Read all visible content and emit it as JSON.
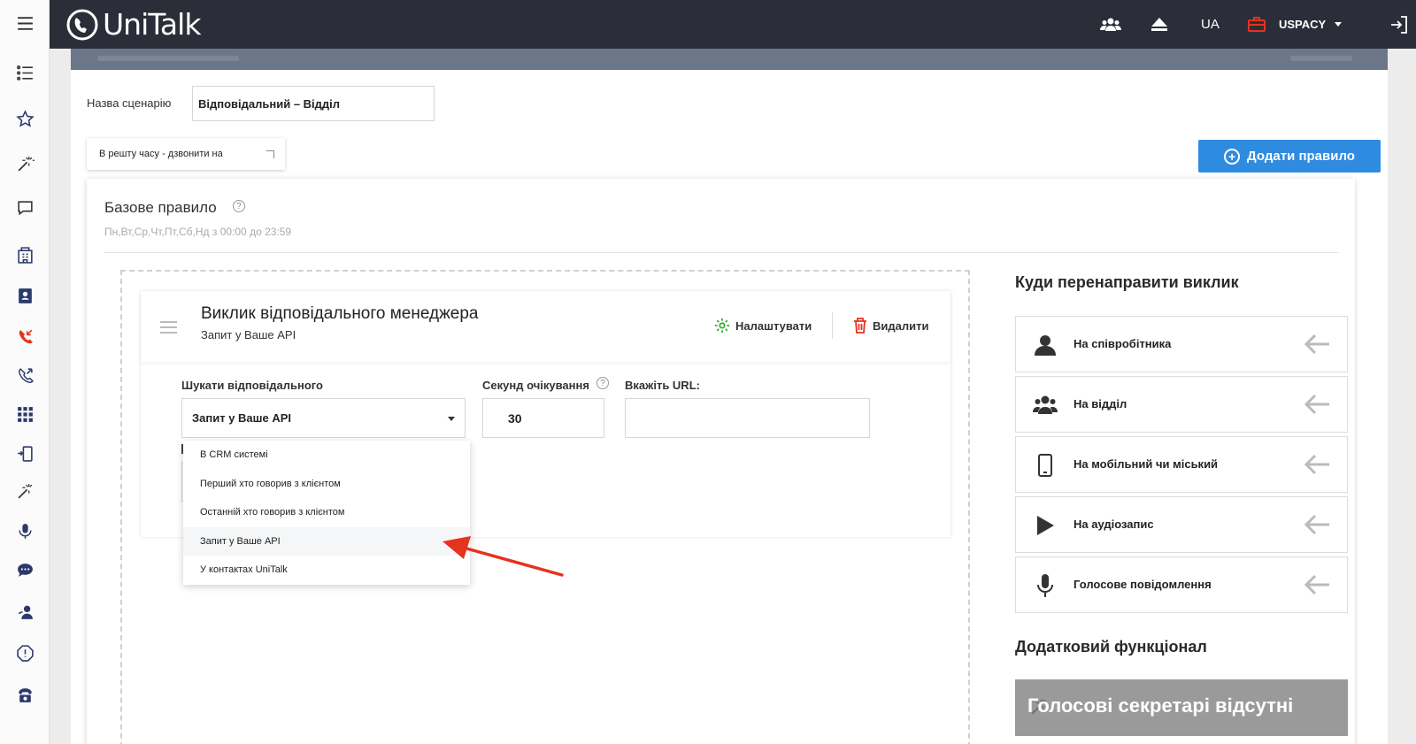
{
  "app": {
    "logo_text": "UniTalk"
  },
  "topbar": {
    "lang": "UA",
    "user": "USPACY"
  },
  "colors": {
    "primary_button": "#2f8be0",
    "topbar": "#2b2e38",
    "band": "#6b7689",
    "arrow_annotation": "#e5331f"
  },
  "sidebar": {
    "icons": [
      "menu-icon",
      "list-icon",
      "star-icon",
      "magic-wand-icon",
      "chat-icon",
      "building-icon",
      "contacts-icon",
      "incoming-call-icon",
      "outgoing-call-icon",
      "apps-grid-icon",
      "phone-transfer-icon",
      "magic-wand-icon",
      "microphone-icon",
      "messages-icon",
      "operator-icon",
      "alert-icon",
      "phone-icon"
    ]
  },
  "scenario": {
    "name_label": "Назва сценарію",
    "name_value": "Відповідальний – Відділ",
    "rest_time_label": "В решту часу - дзвонити на",
    "add_rule_label": "Додати правило"
  },
  "rule": {
    "title": "Базове правило",
    "schedule": "Пн,Вт,Ср,Чт,Пт,Сб,Нд з 00:00 до 23:59"
  },
  "manager_card": {
    "title": "Виклик відповідального менеджера",
    "subtitle": "Запит у Ваше API",
    "settings_label": "Налаштувати",
    "delete_label": "Видалити",
    "search_label": "Шукати відповідального",
    "search_value": "Запит у Ваше API",
    "wait_label": "Секунд очікування",
    "wait_value": "30",
    "url_label": "Вкажіть URL:",
    "url_value": ""
  },
  "dropdown": {
    "options": [
      "В CRM системі",
      "Перший хто говорив з клієнтом",
      "Останній хто говорив з клієнтом",
      "Запит у Ваше API",
      "У контактах UniTalk"
    ],
    "highlighted_index": 3
  },
  "redirect": {
    "title": "Куди перенаправити виклик",
    "items": [
      {
        "label": "На співробітника",
        "icon": "person-icon"
      },
      {
        "label": "На відділ",
        "icon": "group-icon"
      },
      {
        "label": "На мобільний чи міський",
        "icon": "mobile-icon"
      },
      {
        "label": "На аудіозапис",
        "icon": "play-icon"
      },
      {
        "label": "Голосове повідомлення",
        "icon": "microphone-icon"
      }
    ]
  },
  "extra": {
    "title": "Додатковий функціонал",
    "empty_message": "Голосові секретарі відсутні"
  }
}
